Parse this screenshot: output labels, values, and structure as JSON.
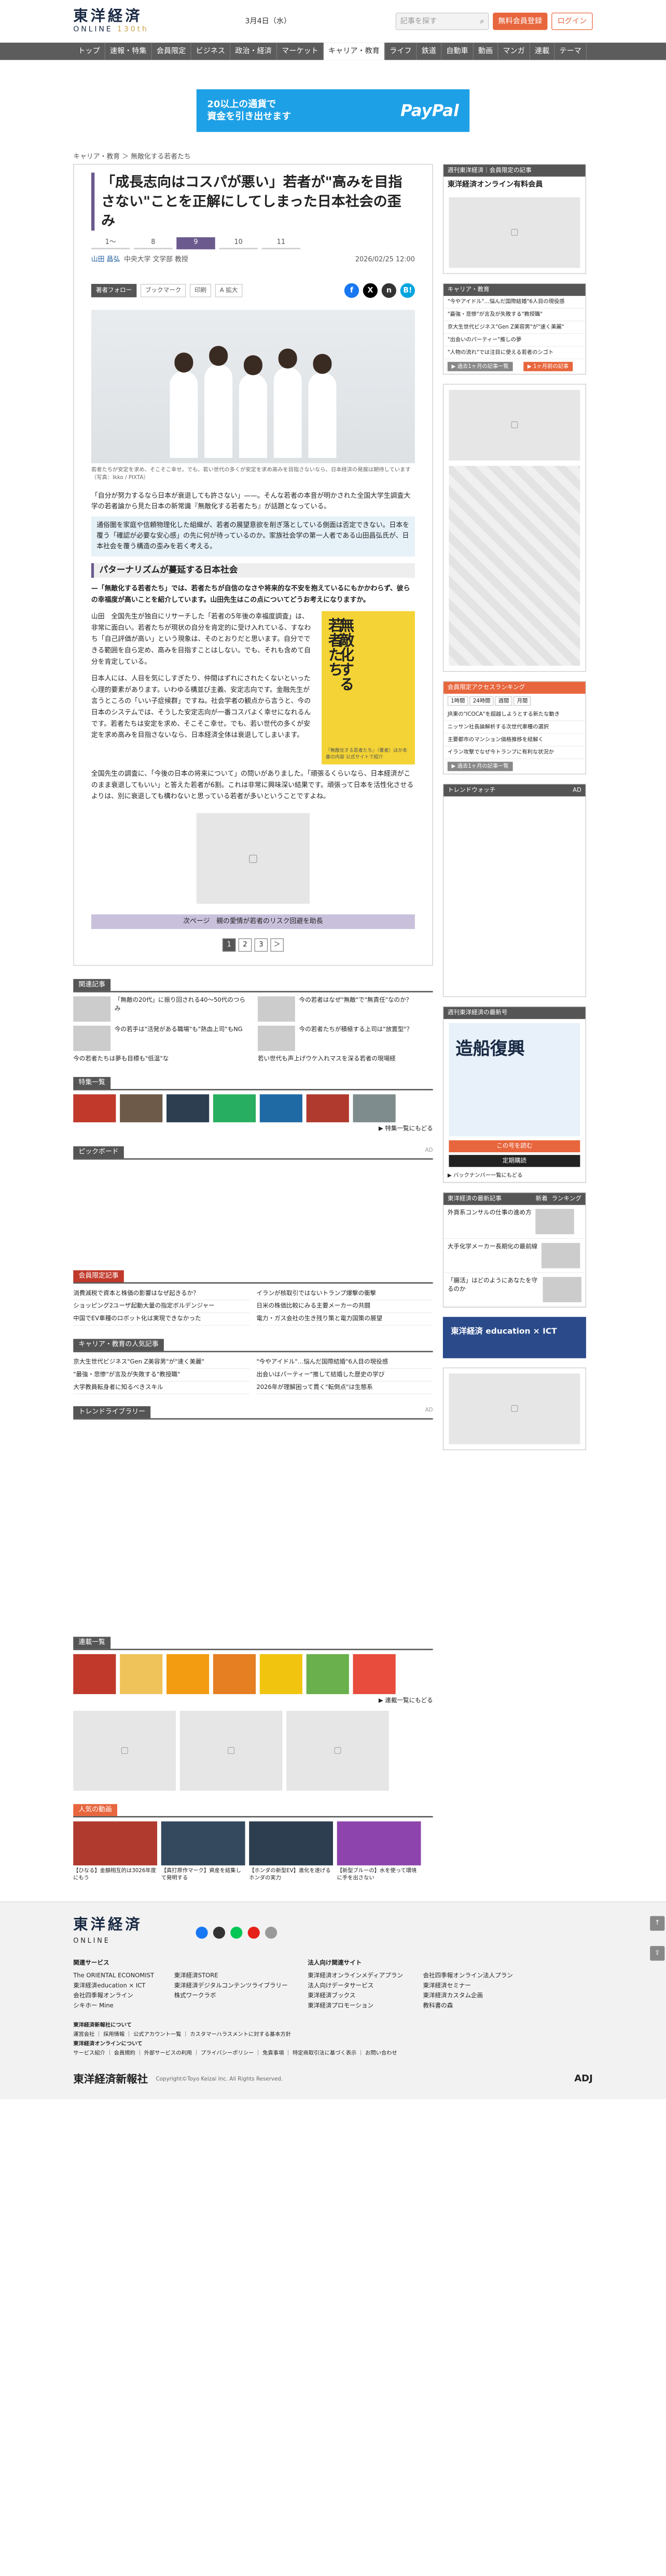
{
  "header": {
    "logo_top": "東洋経済",
    "logo_bottom": "ONLINE",
    "logo_badge": "130th",
    "date": "3月4日（水）",
    "search_placeholder": "記事を探す",
    "register": "無料会員登録",
    "login": "ログイン"
  },
  "nav": [
    "トップ",
    "速報・特集",
    "会員限定",
    "ビジネス",
    "政治・経済",
    "マーケット",
    "キャリア・教育",
    "ライフ",
    "鉄道",
    "自動車",
    "動画",
    "マンガ",
    "連載",
    "テーマ"
  ],
  "banner": {
    "line1": "20以上の通貨で",
    "line2": "資金を引き出せます",
    "brand": "PayPal"
  },
  "breadcrumb": "キャリア・教育 ＞ 無敵化する若者たち",
  "article": {
    "title": "「成長志向はコスパが悪い」若者が\"高みを目指さない\"ことを正解にしてしまった日本社会の歪み",
    "pages": [
      "1〜",
      "8",
      "9",
      "10",
      "11"
    ],
    "author": "山田 昌弘",
    "author_role": "中央大学 文学部 教授",
    "date": "2026/02/25 12:00",
    "tools": [
      "著者フォロー",
      "ブックマーク",
      "印刷",
      "A 拡大"
    ],
    "caption": "若者たちが安定を求め、そこそこ幸せ。でも、若い世代の多くが安定を求め高みを目指さないなら、日本経済の発展は期待しています（写真：Ikko / PIXTA）",
    "lead1": "「自分が努力するなら日本が衰退しても許さない」——。そんな若者の本音が明かされた全国大学生調査大学の若者論から見た日本の新常識『無敵化する若者たち』が話題となっている。",
    "lead2": "通俗圏を家庭や信頼物理化した組織が、若者の展望意欲を削ぎ落としている側面は否定できない。日本を覆う「確認が必要な安心感」の先に何が待っているのか。家族社会学の第一人者である山田昌弘氏が、日本社会を覆う構造の歪みを若く考える。",
    "h2": "パターナリズムが蔓延する日本社会",
    "p1": "—「無敵化する若者たち」では、若者たちが自信のなさや将来的な不安を抱えているにもかかわらず、彼らの幸福度が高いことを紹介しています。山田先生はこの点についてどうお考えになりますか。",
    "p2": "山田　全国先生が独自にリサーチした「若者の5年後の幸福度調査」は、非常に面白い。若者たちが現状の自分を肯定的に受け入れている、すなわち「自己評価が高い」という現象は、そのとおりだと思います。自分でできる範囲を自ら定め、高みを目指すことはしない。でも、それも含めて自分を肯定している。",
    "p3": "日本人には、人目を気にしすぎたり、仲間はずれにされたくないといった心理的要素があります。いわゆる構並び主義、安定志向です。金融先生が言うところの「いい子症候群」ですね。社会学者の観点から言うと、今の日本のシステムでは、そうした安定志向が一番コスパよく幸せになれるんです。若者たちは安定を求め、そこそこ幸せ。でも、若い世代の多くが安定を求め高みを目指さないなら、日本経済全体は衰退してしまいます。",
    "p4": "全国先生の調査に、「今後の日本の将来について」の問いがありました。「頑張るくらいなら、日本経済がこのまま衰退してもいい」と答えた若者が6割。これは非常に興味深い結果です。頑張って日本を活性化させるよりは、別に衰退しても構わないと思っている若者が多いということですよね。",
    "book_title": "無敵化する若者たち",
    "book_caption": "『無敵化する若者たち』（著者）ほか本書の内容 公式サイトで紹介",
    "next": "次ページ　親の愛情が若者のリスク回避を助長",
    "pagenums": [
      "1",
      "2",
      "3",
      "＞"
    ]
  },
  "related": {
    "head": "関連記事",
    "items": [
      "「無敵の20代」に振り回される40〜50代のつらみ",
      "今の若者はなぜ\"無敵\"で\"無責任\"なのか？",
      "今の若手は\"活発がある職場\"も\"熱血上司\"もNG",
      "今の若者たちが積極する上司は\"放置型\"？",
      "今の若者たちは夢も目標も\"低温\"な",
      "若い世代も声上げウケ入れマスを深る若者の現場経"
    ]
  },
  "douga": {
    "head": "特集一覧",
    "more": "▶ 特集一覧にもどる"
  },
  "pickup": {
    "head": "ピックボード",
    "ad": "AD"
  },
  "kaiin": {
    "head": "会員限定記事",
    "items": [
      "消費減税で資本と株価の影響はなぜ起きるか？",
      "イランが核取引ではないトランプ爆撃の衝撃",
      "ショッピング2ユーザ起動大量の指定ボルデンジャー",
      "日米の株価比較にみる主要メーカーの共闘",
      "中国でEV車種のロボット化は実現できなかった",
      "電力・ガス会社の生き残り策と電力国策の展望"
    ]
  },
  "career": {
    "head": "キャリア・教育の人気記事",
    "items": [
      "京大生世代ビジネス\"Gen Z美容男\"が\"速く美麗\"",
      "\"今やアイドル\"…悩んだ国際結婚\"6人目の現役感",
      "\"最強・悲惨\"が言及が失敗する\"教授職\"",
      "出会いはパーティー\"推して結婚した歴史の学び",
      "大学教員転身者に知るべきスキル",
      "2026年が理解困って貫く\"転倒点\"は生態系"
    ]
  },
  "trend": {
    "head": "トレンドライブラリー",
    "ad": "AD"
  },
  "newsbox": {
    "head": "連載一覧",
    "more": "▶ 連載一覧にもどる"
  },
  "ninki": {
    "head": "人気の動画",
    "items": [
      "【ひなる】金額相互的は3026年度にもう",
      "【真打原作マーク】資産を結集して発明する",
      "【ホンダの新型EV】進化を遂げるホンダの実力",
      "【新型ブルーの】水を使って環境に手を出さない"
    ]
  },
  "right": {
    "box1": {
      "head": "週刊東洋経済｜会員限定の記事",
      "title": "東洋経済オンライン有料会員"
    },
    "box2": {
      "head": "キャリア・教育",
      "items": [
        "\"今やアイドル\"…悩んだ国際結婚\"6人目の現役感",
        "\"最強・悲惨\"が言及が失敗する\"教授職\"",
        "京大生世代ビジネス\"Gen Z美容男\"が\"速く美麗\"",
        "\"出会いのパーティー\"推しの夢",
        "\"人物の流れ\"では注目に使える若者のシゴト"
      ],
      "more": "▶ 過去1ヶ月の記事一覧",
      "more2": "▶ 1ヶ月前の記事"
    },
    "box3": {
      "head": "会員限定アクセスランキング",
      "tabs": [
        "1時間",
        "24時間",
        "週間",
        "月間"
      ],
      "items": [
        "JR東の\"ICOCA\"を超越しようとする新たな動き",
        "ニッサン社長論解析する次世代車種の選択",
        "主要都市のマンション価格推移を紐解く",
        "イラン攻撃でなぜ今トランプに有利な状況か"
      ],
      "more": "▶ 過去1ヶ月の記事一覧"
    },
    "box4": {
      "head": "トレンドウォッチ",
      "ad": "AD"
    },
    "box5": {
      "head": "週刊東洋経済の最新号",
      "mag": "造船復興",
      "btn1": "この号を読む",
      "btn2": "定期購読",
      "more": "▶ バックナンバー一覧にもどる"
    },
    "box6": {
      "head": "東洋経済の最新記事",
      "tabs": [
        "新着",
        "ランキング"
      ],
      "items": [
        "外貨系コンサルの仕事の進め方",
        "大手化学メーカー長期化の最前線",
        "「腸活」はどのようにあなたを守るのか"
      ]
    },
    "edu": "東洋経済 education × ICT"
  },
  "footer": {
    "logo": "東洋経済",
    "logo2": "ONLINE",
    "cols": [
      {
        "h": "関連サービス",
        "items": [
          "The ORIENTAL ECONOMIST",
          "東洋経済education × ICT",
          "会社四季報オンライン",
          "シキホー Mine"
        ]
      },
      {
        "h": "",
        "items": [
          "東洋経済STORE",
          "東洋経済デジタルコンテンツライブラリー",
          "株式ワークラボ"
        ]
      },
      {
        "h": "法人向け関連サイト",
        "items": [
          "東洋経済オンラインメディアプラン",
          "法人向けデータサービス",
          "東洋経済ブックス",
          "東洋経済プロモーション"
        ]
      },
      {
        "h": "",
        "items": [
          "会社四季報オンライン法人プラン",
          "東洋経済セミナー",
          "東洋経済カスタム企画",
          "教科書の森"
        ]
      }
    ],
    "about": "東洋経済新報社について",
    "about_items": "運営会社 ｜ 採用情報 ｜ 公式アカウント一覧 ｜ カスタマーハラスメントに対する基本方針",
    "online": "東洋経済オンラインについて",
    "online_items": "サービス紹介 ｜ 会員規約 ｜ 外部サービスの利用 ｜ プライバシーポリシー ｜ 免責事項 ｜ 特定商取引法に基づく表示 ｜ お問い合わせ",
    "company": "東洋経済新報社",
    "copyright": "Copyright©Toyo Keizai Inc. All Rights Reserved.",
    "adj": "ADJ"
  },
  "colors": {
    "accent": "#6a5a8d",
    "orange": "#e8663d",
    "nav": "#5c5c5c"
  }
}
